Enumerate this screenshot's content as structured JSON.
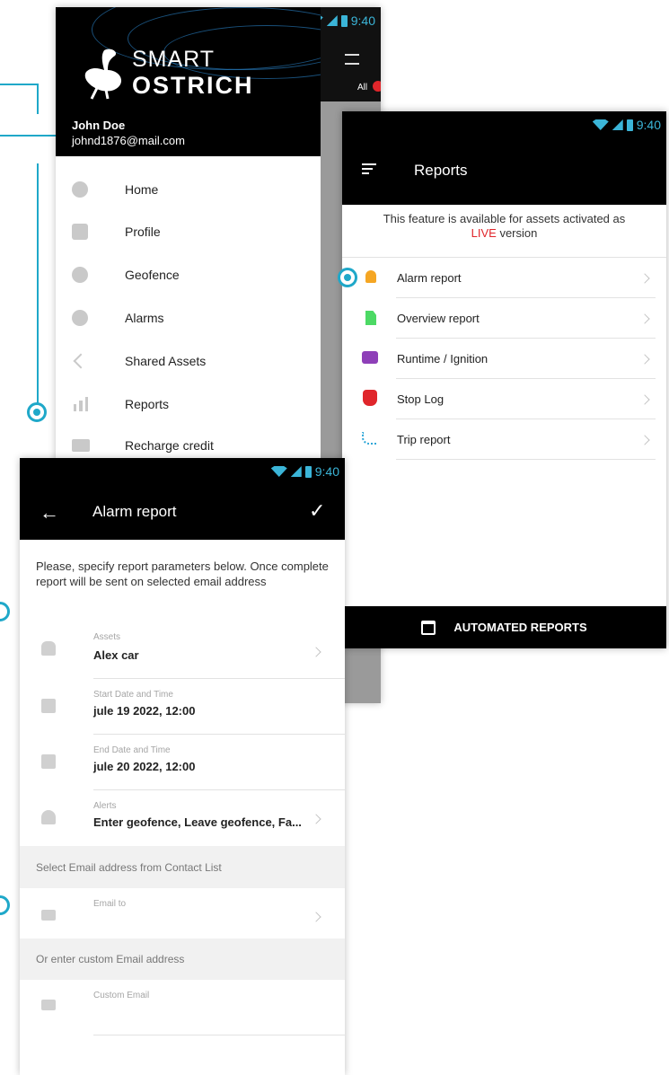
{
  "status_bar": {
    "time": "9:40"
  },
  "drawer": {
    "logo_line1": "SMART",
    "logo_line2": "OSTRICH",
    "user_name": "John Doe",
    "user_email": "johnd1876@mail.com",
    "right_tab_label": "All",
    "items": [
      {
        "label": "Home",
        "icon": "home-icon"
      },
      {
        "label": "Profile",
        "icon": "gear-icon"
      },
      {
        "label": "Geofence",
        "icon": "geofence-icon"
      },
      {
        "label": "Alarms",
        "icon": "alarm-icon"
      },
      {
        "label": "Shared Assets",
        "icon": "share-icon"
      },
      {
        "label": "Reports",
        "icon": "bar-chart-icon"
      },
      {
        "label": "Recharge credit",
        "icon": "credit-card-icon"
      }
    ]
  },
  "reports": {
    "title": "Reports",
    "notice_text": "This feature is available for assets activated as",
    "notice_highlight": "LIVE",
    "notice_suffix": " version",
    "items": [
      {
        "label": "Alarm report",
        "icon": "bell-icon",
        "color": "#f5a623"
      },
      {
        "label": "Overview report",
        "icon": "document-icon",
        "color": "#4cd964"
      },
      {
        "label": "Runtime / Ignition",
        "icon": "ignition-icon",
        "color": "#8e3fb8"
      },
      {
        "label": "Stop Log",
        "icon": "hand-stop-icon",
        "color": "#e0262b"
      },
      {
        "label": "Trip report",
        "icon": "route-icon",
        "color": "#2fa7d8"
      }
    ],
    "automated_label": "AUTOMATED REPORTS",
    "highlight_color": "#e0262b"
  },
  "alarm_report": {
    "title": "Alarm report",
    "intro": "Please, specify report parameters below. Once complete report will be sent on selected email address",
    "fields": [
      {
        "label": "Assets",
        "value": "Alex car",
        "icon": "car-icon"
      },
      {
        "label": "Start Date and Time",
        "value": "jule 19 2022, 12:00",
        "icon": "calendar-icon"
      },
      {
        "label": "End Date and Time",
        "value": "jule 20 2022, 12:00",
        "icon": "calendar-icon"
      },
      {
        "label": "Alerts",
        "value": "Enter geofence, Leave geofence, Fa...",
        "icon": "bell-icon"
      }
    ],
    "contact_section": "Select Email address from Contact List",
    "email_to_label": "Email to",
    "custom_section": "Or enter custom Email address",
    "custom_email_placeholder": "Custom Email"
  },
  "accent_color": "#1fa8c9"
}
